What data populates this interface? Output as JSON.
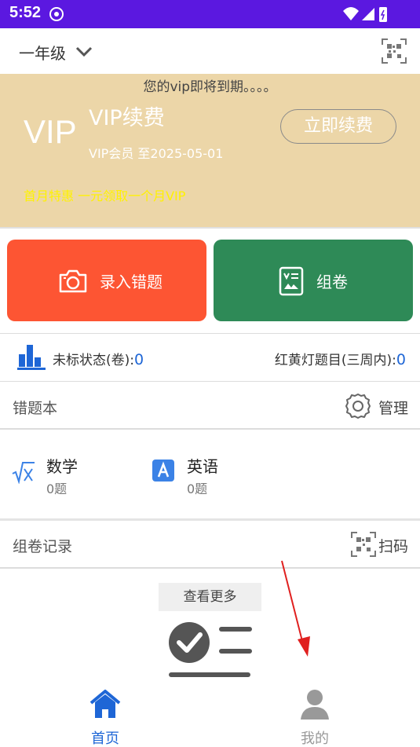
{
  "status_bar": {
    "time": "5:52"
  },
  "topbar": {
    "grade": "一年级"
  },
  "vip": {
    "expire_notice": "您的vip即将到期。。。。",
    "big_text": "VIP",
    "title": "VIP续费",
    "member_until": "VIP会员 至2025-05-01",
    "renew_button": "立即续费",
    "promo": "首月特惠 一元领取一个月VIP"
  },
  "actions": {
    "errors_label": "录入错题",
    "paper_label": "组卷"
  },
  "stats": {
    "unmarked_label": "未标状态(卷):",
    "unmarked_value": "0",
    "traffic_label": "红黄灯题目(三周内):",
    "traffic_value": "0"
  },
  "error_book": {
    "title": "错题本",
    "manage_label": "管理"
  },
  "subjects": [
    {
      "name": "数学",
      "count": "0题",
      "icon": "sqrt-x-icon"
    },
    {
      "name": "英语",
      "count": "0题",
      "icon": "letter-a-icon"
    }
  ],
  "paper_records": {
    "title": "组卷记录",
    "scan_label": "扫码",
    "more_button": "查看更多"
  },
  "tabs": [
    {
      "label": "首页",
      "icon": "home-icon",
      "active": true
    },
    {
      "label": "我的",
      "icon": "person-icon",
      "active": false
    }
  ],
  "colors": {
    "status_bar": "#5b18e0",
    "vip_banner": "#ecd6a8",
    "promo_text": "#fff200",
    "errors_card": "#fd5533",
    "paper_card": "#2e8a57",
    "accent_blue": "#1e66d6",
    "arrow_red": "#e0201f"
  }
}
